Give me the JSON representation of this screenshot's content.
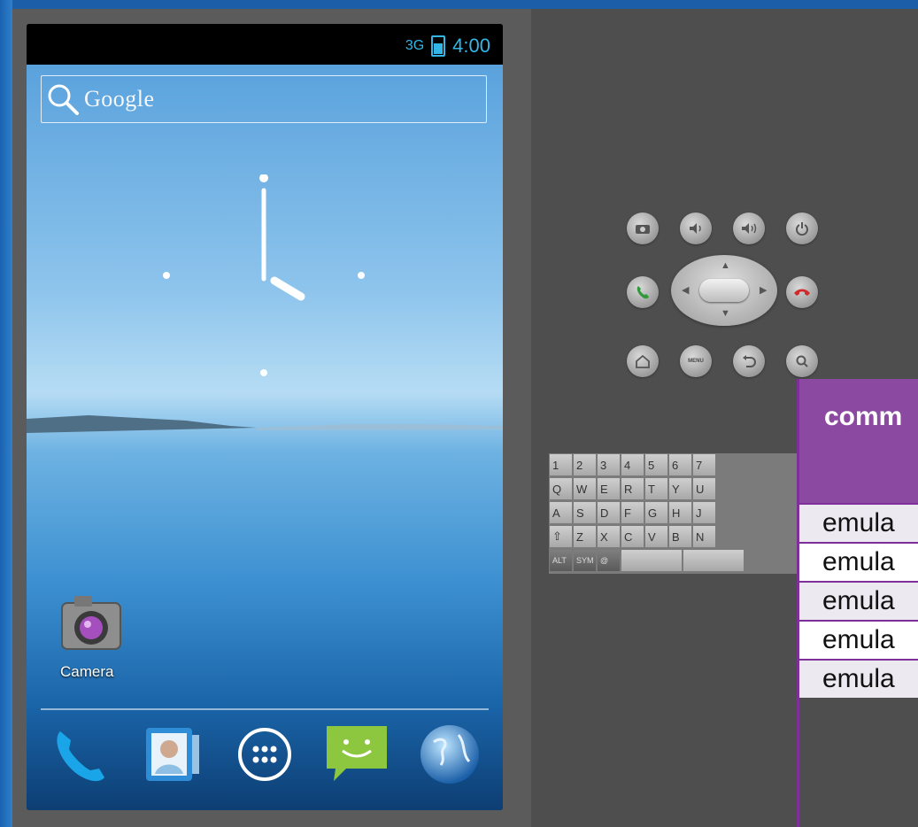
{
  "status_bar": {
    "network": "3G",
    "time": "4:00"
  },
  "search": {
    "placeholder": "Google"
  },
  "home": {
    "shortcut_label": "Camera"
  },
  "dock": {
    "items": [
      "phone-icon",
      "contacts-icon",
      "app-drawer-icon",
      "messaging-icon",
      "browser-icon"
    ]
  },
  "hardware_controls": {
    "row1": [
      "camera",
      "volume-down",
      "volume-up",
      "power"
    ],
    "dpad_row": [
      "call",
      "dpad",
      "end-call"
    ],
    "row3": [
      "home",
      "menu",
      "back",
      "search"
    ],
    "menu_label": "MENU"
  },
  "keyboard": {
    "rows": [
      [
        "1",
        "2",
        "3",
        "4",
        "5",
        "6",
        "7"
      ],
      [
        "Q",
        "W",
        "E",
        "R",
        "T",
        "Y",
        "U"
      ],
      [
        "A",
        "S",
        "D",
        "F",
        "G",
        "H",
        "J"
      ],
      [
        "⇧",
        "Z",
        "X",
        "C",
        "V",
        "B",
        "N"
      ]
    ],
    "bottom": [
      "ALT",
      "SYM",
      "@"
    ]
  },
  "command_table": {
    "header": "comm",
    "rows": [
      "emula",
      "emula",
      "emula",
      "emula",
      "emula"
    ]
  }
}
